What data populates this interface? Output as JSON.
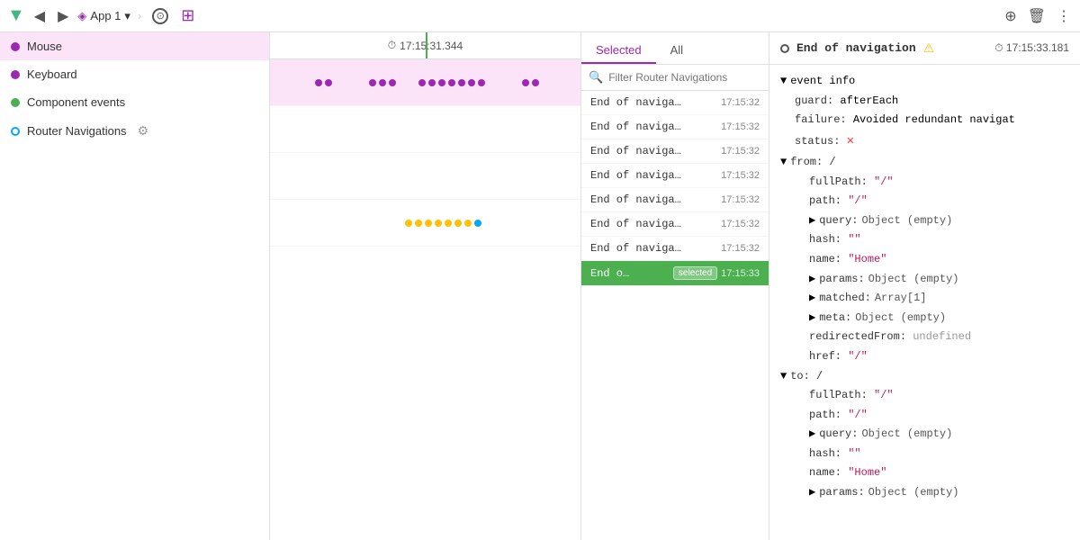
{
  "toolbar": {
    "back_label": "◀",
    "forward_label": "▶",
    "app_name": "App 1",
    "dropdown_icon": "▾",
    "separator": "›",
    "compass_label": "⊙",
    "grid_label": "⊞",
    "add_icon": "⊕",
    "delete_icon": "🗑",
    "more_icon": "⋮"
  },
  "timeline": {
    "timestamp": "17:15:31.344"
  },
  "sidebar": {
    "items": [
      {
        "id": "mouse",
        "label": "Mouse",
        "dot_type": "filled",
        "dot_color": "#9C27B0"
      },
      {
        "id": "keyboard",
        "label": "Keyboard",
        "dot_type": "filled",
        "dot_color": "#9C27B0"
      },
      {
        "id": "component-events",
        "label": "Component events",
        "dot_type": "filled",
        "dot_color": "#4CAF50"
      },
      {
        "id": "router-navigations",
        "label": "Router Navigations",
        "dot_type": "outline",
        "dot_color": "#03A9F4"
      }
    ]
  },
  "events_panel": {
    "tabs": [
      {
        "id": "selected",
        "label": "Selected"
      },
      {
        "id": "all",
        "label": "All"
      }
    ],
    "active_tab": "selected",
    "search_placeholder": "Filter Router Navigations",
    "events": [
      {
        "name": "End of naviga…",
        "time": "17:15:32",
        "selected": false
      },
      {
        "name": "End of naviga…",
        "time": "17:15:32",
        "selected": false
      },
      {
        "name": "End of naviga…",
        "time": "17:15:32",
        "selected": false
      },
      {
        "name": "End of naviga…",
        "time": "17:15:32",
        "selected": false
      },
      {
        "name": "End of naviga…",
        "time": "17:15:32",
        "selected": false
      },
      {
        "name": "End of naviga…",
        "time": "17:15:32",
        "selected": false
      },
      {
        "name": "End of naviga…",
        "time": "17:15:32",
        "selected": false
      },
      {
        "name": "End o…",
        "time": "17:15:33",
        "selected": true,
        "badge": "selected"
      }
    ]
  },
  "detail": {
    "event_name": "End of navigation",
    "warning": "⚠",
    "time_icon": "⏱",
    "time": "17:15:33.181",
    "section_label": "event info",
    "fields": [
      {
        "indent": 1,
        "key": "guard:",
        "value": "afterEach",
        "type": "plain"
      },
      {
        "indent": 1,
        "key": "failure:",
        "value": "Avoided redundant navigat",
        "type": "plain"
      },
      {
        "indent": 1,
        "key": "status:",
        "value": "✕",
        "type": "error"
      },
      {
        "indent": 0,
        "key": "▼ from:",
        "value": "/",
        "type": "section"
      },
      {
        "indent": 2,
        "key": "fullPath:",
        "value": "\"/\"",
        "type": "string"
      },
      {
        "indent": 2,
        "key": "path:",
        "value": "\"/\"",
        "type": "string"
      },
      {
        "indent": 2,
        "key": "▶ query:",
        "value": "Object (empty)",
        "type": "collapse"
      },
      {
        "indent": 2,
        "key": "hash:",
        "value": "\"\"",
        "type": "string"
      },
      {
        "indent": 2,
        "key": "name:",
        "value": "\"Home\"",
        "type": "string"
      },
      {
        "indent": 2,
        "key": "▶ params:",
        "value": "Object (empty)",
        "type": "collapse"
      },
      {
        "indent": 2,
        "key": "▶ matched:",
        "value": "Array[1]",
        "type": "collapse"
      },
      {
        "indent": 2,
        "key": "▶ meta:",
        "value": "Object (empty)",
        "type": "collapse"
      },
      {
        "indent": 2,
        "key": "redirectedFrom:",
        "value": "undefined",
        "type": "null"
      },
      {
        "indent": 2,
        "key": "href:",
        "value": "\"/\"",
        "type": "string"
      },
      {
        "indent": 0,
        "key": "▼ to:",
        "value": "/",
        "type": "section"
      },
      {
        "indent": 2,
        "key": "fullPath:",
        "value": "\"/\"",
        "type": "string"
      },
      {
        "indent": 2,
        "key": "path:",
        "value": "\"/\"",
        "type": "string"
      },
      {
        "indent": 2,
        "key": "▶ query:",
        "value": "Object (empty)",
        "type": "collapse"
      },
      {
        "indent": 2,
        "key": "hash:",
        "value": "\"\"",
        "type": "string"
      },
      {
        "indent": 2,
        "key": "name:",
        "value": "\"Home\"",
        "type": "string"
      },
      {
        "indent": 2,
        "key": "▶ params:",
        "value": "Object (empty)",
        "type": "collapse"
      }
    ]
  }
}
